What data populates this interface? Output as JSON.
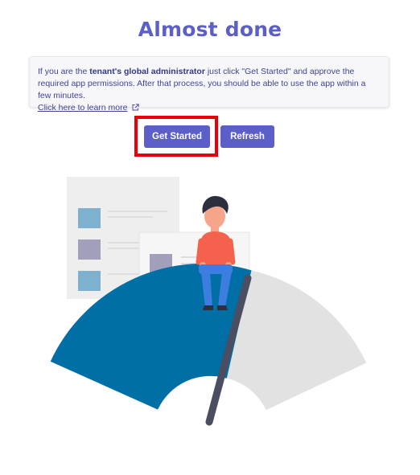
{
  "page": {
    "title": "Almost done"
  },
  "info": {
    "text_before": "If you are the ",
    "bold_text": "tenant's global administrator",
    "text_after": " just click \"Get Started\" and approve the required app permissions. After that process, you should be able to use the app within a few minutes.",
    "link_label": "Click here to learn more",
    "link_icon": "external-link-icon"
  },
  "actions": {
    "get_started_label": "Get Started",
    "refresh_label": "Refresh",
    "highlighted_button": "Get Started"
  },
  "illustration": {
    "name": "speedometer-with-person",
    "gauge_level": 0.6
  },
  "colors": {
    "accent": "#5b5fc7",
    "highlight": "#e8000b",
    "gauge_fill": "#006fa6",
    "gauge_track": "#e2e2e2",
    "needle": "#4b4d61"
  }
}
